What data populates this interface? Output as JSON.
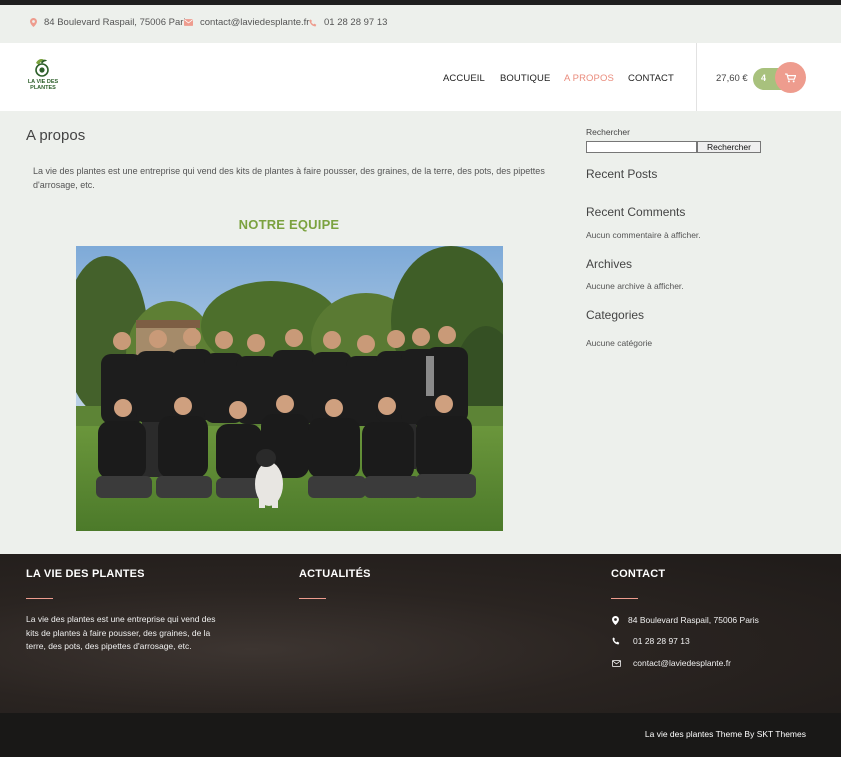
{
  "topbar": {
    "address": "84 Boulevard Raspail, 75006 Paris",
    "email": "contact@laviedesplante.fr",
    "phone": "01 28 28 97 13"
  },
  "header": {
    "logo_text_line1": "LA VIE DES",
    "logo_text_line2": "PLANTES",
    "nav": [
      {
        "label": "ACCUEIL"
      },
      {
        "label": "BOUTIQUE"
      },
      {
        "label": "A PROPOS"
      },
      {
        "label": "CONTACT"
      }
    ],
    "active_nav": "A PROPOS",
    "cart_total": "27,60 €",
    "cart_count": "4",
    "accent_color": "#ea8c7d",
    "cart_green": "#a8c17d"
  },
  "main": {
    "title": "A propos",
    "intro": "La vie des plantes est une entreprise qui vend des kits de plantes à faire pousser, des graines, de la terre, des pots, des pipettes d'arrosage, etc.",
    "team_heading": "NOTRE EQUIPE",
    "team_heading_color": "#7ba23f"
  },
  "sidebar": {
    "search_label": "Rechercher",
    "search_value": "",
    "search_button": "Rechercher",
    "recent_posts_title": "Recent Posts",
    "recent_comments_title": "Recent Comments",
    "recent_comments_empty": "Aucun commentaire à afficher.",
    "archives_title": "Archives",
    "archives_empty": "Aucune archive à afficher.",
    "categories_title": "Categories",
    "categories_empty": "Aucune catégorie"
  },
  "footer": {
    "col1_title": "LA VIE DES PLANTES",
    "col1_text": "La vie des plantes est une entreprise qui vend des kits de plantes à faire pousser, des graines, de la terre, des pots, des pipettes d'arrosage, etc.",
    "col2_title": "ACTUALITÉS",
    "col3_title": "CONTACT",
    "address": "84 Boulevard Raspail, 75006 Paris",
    "phone": "01 28 28 97 13",
    "email": "contact@laviedesplante.fr",
    "credit": "La vie des plantes Theme By SKT Themes"
  }
}
